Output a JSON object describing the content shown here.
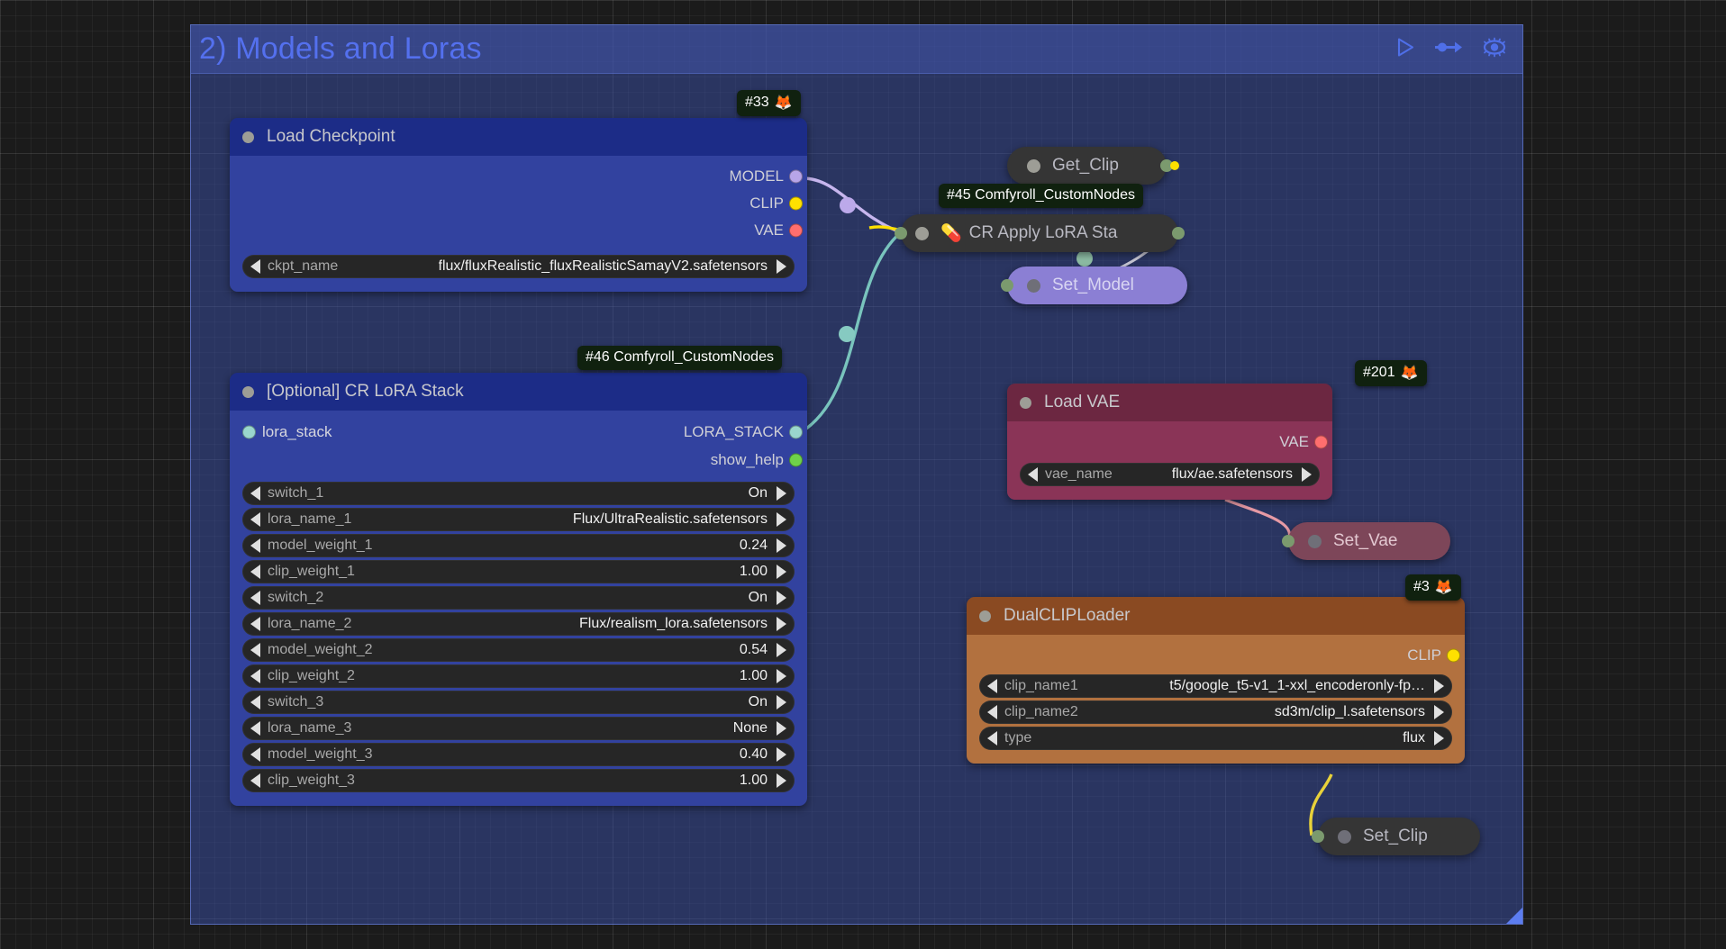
{
  "group": {
    "title": "2) Models and Loras",
    "color": "#3a50a8",
    "tools": [
      {
        "name": "run-group-icon",
        "glyph": "play-triangle"
      },
      {
        "name": "bypass-group-icon",
        "glyph": "node-arrow"
      },
      {
        "name": "toggle-visibility-icon",
        "glyph": "eye"
      }
    ]
  },
  "badges": [
    {
      "id": "badge-33",
      "text": "#33",
      "emoji": "🦊"
    },
    {
      "id": "badge-45",
      "text": "#45 Comfyroll_CustomNodes",
      "emoji": ""
    },
    {
      "id": "badge-46",
      "text": "#46 Comfyroll_CustomNodes",
      "emoji": ""
    },
    {
      "id": "badge-201",
      "text": "#201",
      "emoji": "🦊"
    },
    {
      "id": "badge-3",
      "text": "#3",
      "emoji": "🦊"
    }
  ],
  "nodes": {
    "load_checkpoint": {
      "title": "Load Checkpoint",
      "outputs": [
        {
          "label": "MODEL",
          "color": "#b7a5e8"
        },
        {
          "label": "CLIP",
          "color": "#ffe000"
        },
        {
          "label": "VAE",
          "color": "#ff6e6e"
        }
      ],
      "widgets": [
        {
          "name": "ckpt_name",
          "value": "flux/fluxRealistic_fluxRealisticSamayV2.safetensors"
        }
      ]
    },
    "lora_stack": {
      "title": "[Optional] CR LoRA Stack",
      "inputs": [
        {
          "label": "lora_stack",
          "color": "#9ad6cd"
        }
      ],
      "outputs": [
        {
          "label": "LORA_STACK",
          "color": "#9ad6cd"
        },
        {
          "label": "show_help",
          "color": "#6fd14a"
        }
      ],
      "widgets": [
        {
          "name": "switch_1",
          "value": "On"
        },
        {
          "name": "lora_name_1",
          "value": "Flux/UltraRealistic.safetensors"
        },
        {
          "name": "model_weight_1",
          "value": "0.24"
        },
        {
          "name": "clip_weight_1",
          "value": "1.00"
        },
        {
          "name": "switch_2",
          "value": "On"
        },
        {
          "name": "lora_name_2",
          "value": "Flux/realism_lora.safetensors"
        },
        {
          "name": "model_weight_2",
          "value": "0.54"
        },
        {
          "name": "clip_weight_2",
          "value": "1.00"
        },
        {
          "name": "switch_3",
          "value": "On"
        },
        {
          "name": "lora_name_3",
          "value": "None"
        },
        {
          "name": "model_weight_3",
          "value": "0.40"
        },
        {
          "name": "clip_weight_3",
          "value": "1.00"
        }
      ]
    },
    "load_vae": {
      "title": "Load VAE",
      "outputs": [
        {
          "label": "VAE",
          "color": "#ff6e6e"
        }
      ],
      "widgets": [
        {
          "name": "vae_name",
          "value": "flux/ae.safetensors"
        }
      ]
    },
    "dual_clip_loader": {
      "title": "DualCLIPLoader",
      "outputs": [
        {
          "label": "CLIP",
          "color": "#ffe000"
        }
      ],
      "widgets": [
        {
          "name": "clip_name1",
          "value": "t5/google_t5-v1_1-xxl_encoderonly-fp…"
        },
        {
          "name": "clip_name2",
          "value": "sd3m/clip_l.safetensors"
        },
        {
          "name": "type",
          "value": "flux"
        }
      ]
    },
    "get_clip": {
      "title": "Get_Clip"
    },
    "cr_apply_lora": {
      "title": "CR Apply LoRA Sta",
      "emoji": "💊"
    },
    "set_model": {
      "title": "Set_Model"
    },
    "set_vae": {
      "title": "Set_Vae"
    },
    "set_clip": {
      "title": "Set_Clip"
    }
  }
}
